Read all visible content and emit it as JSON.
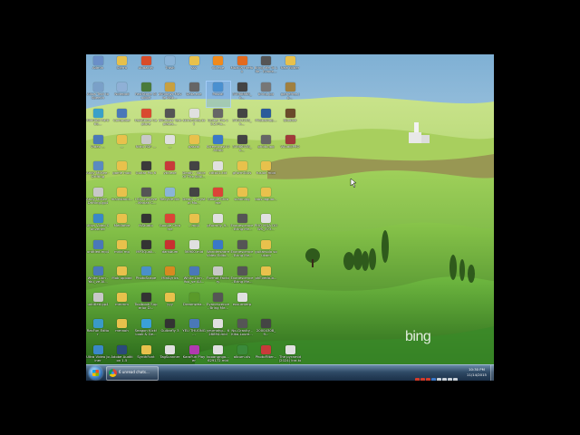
{
  "desktop": {
    "icons": [
      {
        "label": "Admin",
        "color": "#6a8fc8"
      },
      {
        "label": "Sierra",
        "color": "#e6c04c"
      },
      {
        "label": "Audacity",
        "color": "#d84c2a"
      },
      {
        "label": "Trash",
        "color": "#8ab4d8"
      },
      {
        "label": "sss",
        "color": "#e8c14c"
      },
      {
        "label": "vlc.exe",
        "color": "#f08a1c"
      },
      {
        "label": "Mozilla Firefox",
        "color": "#e36a1e"
      },
      {
        "label": "Bring Me To Life - Evane...",
        "color": "#555"
      },
      {
        "label": "New folder",
        "color": "#e8c14c"
      },
      {
        "label": "Allow Text to Speech",
        "color": "#7aa0c8"
      },
      {
        "label": "Notepad",
        "color": "#8fb0d6"
      },
      {
        "label": "FastStone Studio9",
        "color": "#4a7a3a"
      },
      {
        "label": "Windows Movie Mak...",
        "color": "#c8a040"
      },
      {
        "label": "Data.exe",
        "color": "#666"
      },
      {
        "label": "Pascal",
        "color": "#4a90d0",
        "selected": true
      },
      {
        "label": "34968868_n...",
        "color": "#444"
      },
      {
        "label": "bring.jpg",
        "color": "#777"
      },
      {
        "label": "gamefree.jp...",
        "color": "#a08040"
      },
      {
        "label": "MiniTool Partitio...",
        "color": "#3aa0c8"
      },
      {
        "label": "Computer",
        "color": "#4a78b8"
      },
      {
        "label": "FastStone Capture",
        "color": "#d84a30"
      },
      {
        "label": "Windows Templates...",
        "color": "#555"
      },
      {
        "label": "skins-links.txt",
        "color": "#e0e0e0"
      },
      {
        "label": "Guitar Pro v5.2.Plu...",
        "color": "#666"
      },
      {
        "label": "34053233_n...",
        "color": "#444"
      },
      {
        "label": "Photoshop...",
        "color": "#2a5a9a"
      },
      {
        "label": "Studio9",
        "color": "#6a4a2a"
      },
      {
        "label": "Video ...",
        "color": "#4a78b8"
      },
      {
        "label": "...",
        "color": "#e8c14c"
      },
      {
        "label": "Nitro PDF ...",
        "color": "#c8c8c8"
      },
      {
        "label": "...",
        "color": "#e0e0e0"
      },
      {
        "label": "pascal",
        "color": "#e8c14c"
      },
      {
        "label": "Screencast-O-Matic",
        "color": "#3a78c8"
      },
      {
        "label": "34986438_n...",
        "color": "#444"
      },
      {
        "label": "photo.jpg",
        "color": "#666"
      },
      {
        "label": "VAudioPRO",
        "color": "#a03a3a"
      },
      {
        "label": "Andy McKee - Drifting",
        "color": "#5a8ac0"
      },
      {
        "label": "game mod",
        "color": "#e8c14c"
      },
      {
        "label": "Guitar Pro 6",
        "color": "#3a3a3a"
      },
      {
        "label": "ytd.exe",
        "color": "#c83a3a"
      },
      {
        "label": "Death - Voice Of The Soul...",
        "color": "#444"
      },
      {
        "label": "cdtp01.txt",
        "color": "#e0e0e0"
      },
      {
        "label": "gFormToUs",
        "color": "#e8c14c"
      },
      {
        "label": "fusion mod",
        "color": "#e8c14c"
      },
      {
        "label": "Andy McKee - Drifting.gp4",
        "color": "#c8c8c8"
      },
      {
        "label": "mainstand...",
        "color": "#e8c14c"
      },
      {
        "label": "I Still Believe - Mariah C...",
        "color": "#555"
      },
      {
        "label": "Recycle Bin",
        "color": "#8ab4d8"
      },
      {
        "label": "Death - Crystal Mo...",
        "color": "#444"
      },
      {
        "label": "Google Chrome",
        "color": "#db4437"
      },
      {
        "label": "scanning",
        "color": "#e8c14c"
      },
      {
        "label": "tabs laguar...",
        "color": "#e8c14c"
      },
      {
        "label": "Ultra Video Converter",
        "color": "#3a88c8"
      },
      {
        "label": "Mediafire",
        "color": "#e8c14c"
      },
      {
        "label": "fsStudio",
        "color": "#333"
      },
      {
        "label": "Google Chrome",
        "color": "#db4437"
      },
      {
        "label": "...mp4",
        "color": "#e8c14c"
      },
      {
        "label": "gFormfly_9...",
        "color": "#e0e0e0"
      },
      {
        "label": "Evanescence - Bring Me...",
        "color": "#555"
      },
      {
        "label": "PHO M&A DOWS_373...",
        "color": "#e0e0e0"
      },
      {
        "label": "untitled.mp4",
        "color": "#4a78b8"
      },
      {
        "label": "mvid mp",
        "color": "#e8c14c"
      },
      {
        "label": "MP3Quali...",
        "color": "#333"
      },
      {
        "label": "dansbum",
        "color": "#c83030"
      },
      {
        "label": "56900.mid",
        "color": "#e0e0e0"
      },
      {
        "label": "Wondershare Video Edito...",
        "color": "#3a78c8"
      },
      {
        "label": "Evanescence - Bring Me...",
        "color": "#555"
      },
      {
        "label": "guitarsolo soukam",
        "color": "#e8c14c"
      },
      {
        "label": "White Lion - You_ve Al...",
        "color": "#4a78b8"
      },
      {
        "label": "Mob upload",
        "color": "#e8c14c"
      },
      {
        "label": "PhotoScape",
        "color": "#4a90c8"
      },
      {
        "label": "MiniLyrics",
        "color": "#d88a20"
      },
      {
        "label": "White Lion - You_ve All...",
        "color": "#4a78b8"
      },
      {
        "label": "Format Factory",
        "color": "#c8c8c8"
      },
      {
        "label": "Evanescence - Bring Me...",
        "color": "#555"
      },
      {
        "label": "phEvedo-b...",
        "color": "#e8c14c"
      },
      {
        "label": "untitled.gp4",
        "color": "#c8c8c8"
      },
      {
        "label": "mmmm",
        "color": "#e8c14c"
      },
      {
        "label": "Toolbook Superior D...",
        "color": "#333"
      },
      {
        "label": "yyy",
        "color": "#e8c14c"
      },
      {
        "label": "Dreamwea...",
        "color": "#5a9a2a"
      },
      {
        "label": "Evanescence - Bring Me...",
        "color": "#555"
      },
      {
        "label": "eusumterp",
        "color": "#e0e0e0"
      },
      {
        "label": "RasFun Editor",
        "color": "#3a9ac8"
      },
      {
        "label": "mmnoh",
        "color": "#e8c14c"
      },
      {
        "label": "Seagon Kick! Look & Ge...",
        "color": "#3aa0d8"
      },
      {
        "label": "Guitarfly 3",
        "color": "#333"
      },
      {
        "label": "YEU THUONG ...",
        "color": "#4a78b8"
      },
      {
        "label": "yeumahg... 628894.mid",
        "color": "#e0e0e0"
      },
      {
        "label": "No-Gravity - Kiko-Loure...",
        "color": "#555"
      },
      {
        "label": "20004308_9...",
        "color": "#444"
      },
      {
        "label": "Ultra Video Joiner",
        "color": "#3a88c8"
      },
      {
        "label": "Adobe Audition 1.5",
        "color": "#2a4a7a"
      },
      {
        "label": "SynthFont",
        "color": "#e8c14c"
      },
      {
        "label": "TagScanner",
        "color": "#e0e0e0"
      },
      {
        "label": "KaraFun Player",
        "color": "#b03ab0"
      },
      {
        "label": "kooangngo... 629172.mid",
        "color": "#e0e0e0"
      },
      {
        "label": "album.xls",
        "color": "#3a8a3a"
      },
      {
        "label": "PhotoFilter...",
        "color": "#c83a3a"
      },
      {
        "label": "The pyramid (2024) kra.txt",
        "color": "#e0e0e0"
      }
    ]
  },
  "watermark": {
    "text": "bing"
  },
  "taskbar": {
    "app_title": "6 unread chats...",
    "clock_time": "10:30 PM",
    "clock_date": "11/14/2015"
  },
  "tray_icons": [
    "red",
    "red",
    "red",
    "blue",
    "gray",
    "gray",
    "gray",
    "gray"
  ],
  "colors": {
    "sky": "#9fc3de",
    "grass_light": "#a9d35a",
    "grass_dark": "#2f7a1f"
  }
}
